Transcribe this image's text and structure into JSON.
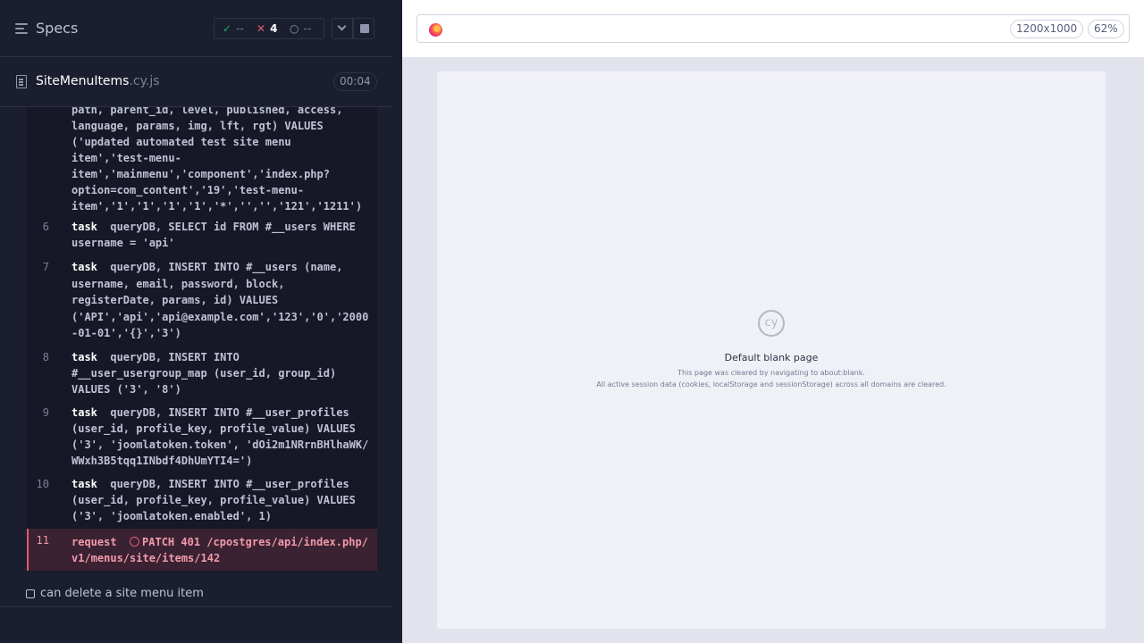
{
  "specs": {
    "title": "Specs",
    "passed": "--",
    "failed": "4",
    "pending": "--"
  },
  "file": {
    "name": "SiteMenuItems",
    "ext": ".cy.js",
    "duration": "00:04"
  },
  "commands": [
    {
      "num": "",
      "lines": [
        "path, parent_id, level, published, access,",
        "language, params, img, lft, rgt) VALUES",
        "('updated automated test site menu",
        "item','test-menu-",
        "item','mainmenu','component','index.php?",
        "option=com_content','19','test-menu-",
        "item','1','1','1','1','*','','','121','1211')"
      ]
    },
    {
      "num": "6",
      "keyword": "task",
      "lines": [
        "queryDB, SELECT id FROM #__users WHERE",
        "username = 'api'"
      ]
    },
    {
      "num": "7",
      "keyword": "task",
      "lines": [
        "queryDB, INSERT INTO #__users (name,",
        "username, email, password, block,",
        "registerDate, params, id) VALUES",
        "('API','api','api@example.com','123','0','2000",
        "-01-01','{}','3')"
      ]
    },
    {
      "num": "8",
      "keyword": "task",
      "lines": [
        "queryDB, INSERT INTO",
        "#__user_usergroup_map (user_id, group_id)",
        "VALUES ('3', '8')"
      ]
    },
    {
      "num": "9",
      "keyword": "task",
      "lines": [
        "queryDB, INSERT INTO #__user_profiles",
        "(user_id, profile_key, profile_value) VALUES",
        "('3', 'joomlatoken.token', 'dOi2m1NRrnBHlhaWK/",
        "WWxh3B5tqq1INbdf4DhUmYTI4=')"
      ]
    },
    {
      "num": "10",
      "keyword": "task",
      "lines": [
        "queryDB, INSERT INTO #__user_profiles",
        "(user_id, profile_key, profile_value) VALUES",
        "('3', 'joomlatoken.enabled', 1)"
      ]
    },
    {
      "num": "11",
      "keyword": "request",
      "lines": [
        "PATCH 401 /cpostgres/api/index.php/",
        "v1/menus/site/items/142"
      ]
    }
  ],
  "next_test": "can delete a site menu item",
  "browser": {
    "viewport": "1200x1000",
    "zoom": "62%"
  },
  "blank_page": {
    "logo": "cy",
    "title": "Default blank page",
    "line1": "This page was cleared by navigating to about:blank.",
    "line2": "All active session data (cookies, localStorage and sessionStorage) across all domains are cleared."
  },
  "icons": {
    "menu": "hamburger-icon",
    "pass": "check-icon",
    "fail": "x-icon",
    "pending": "spinner-icon",
    "file": "document-icon",
    "browser": "firefox-icon"
  },
  "colors": {
    "pass": "#1fa971",
    "fail": "#e45770",
    "panel_bg": "#1b1e2e"
  }
}
